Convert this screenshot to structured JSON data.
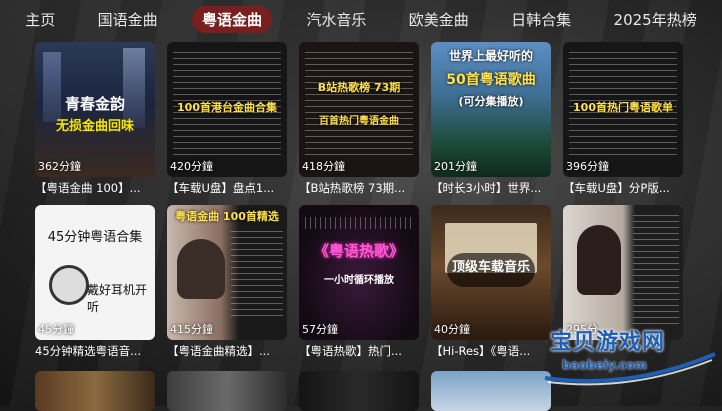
{
  "tabs": [
    "主页",
    "国语金曲",
    "粤语金曲",
    "汽水音乐",
    "欧美金曲",
    "日韩合集",
    "2025年热榜"
  ],
  "active_tab": "粤语金曲",
  "rows": [
    [
      {
        "duration": "362分鐘",
        "caption": "【粤语金曲 100】...",
        "title": "青春金韵",
        "subtitle": "无损金曲回味"
      },
      {
        "duration": "420分鐘",
        "caption": "【车载U盘】盘点1...",
        "title": "100首港台金曲合集",
        "subtitle": ""
      },
      {
        "duration": "418分鐘",
        "caption": "【B站热歌榜 73期...",
        "title": "B站热歌榜 73期",
        "subtitle": "百首热门粤语金曲"
      },
      {
        "duration": "201分鐘",
        "caption": "【时长3小时】世界...",
        "title": "世界上最好听的",
        "subtitle": "50首粤语歌曲",
        "note": "(可分集播放)"
      },
      {
        "duration": "396分鐘",
        "caption": "【车载U盘】分P版...",
        "title": "100首热门粤语歌单",
        "subtitle": ""
      }
    ],
    [
      {
        "duration": "45分鐘",
        "caption": "45分钟精选粤语音...",
        "title": "45分钟粤语合集",
        "subtitle": "戴好耳机开听"
      },
      {
        "duration": "415分鐘",
        "caption": "【粤语金曲精选】...",
        "title": "粤语金曲 100首精选",
        "subtitle": ""
      },
      {
        "duration": "57分鐘",
        "caption": "【粤语热歌】热门...",
        "title": "《粤语热歌》",
        "subtitle": "一小时循环播放"
      },
      {
        "duration": "40分鐘",
        "caption": "【Hi-Res】《粤语...",
        "title": "顶级车载音乐",
        "subtitle": ""
      },
      {
        "duration": "295分",
        "caption": "",
        "title": "",
        "subtitle": ""
      }
    ]
  ],
  "watermark": {
    "brand": "宝贝游戏网",
    "url": "baobeiy.com"
  }
}
